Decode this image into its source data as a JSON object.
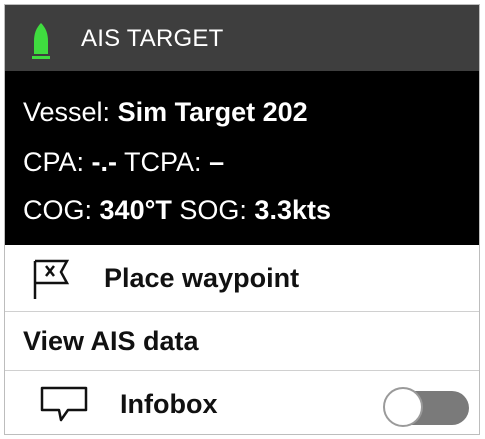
{
  "header": {
    "title": "AIS TARGET",
    "icon": "ais-vessel-icon",
    "icon_color": "#3fdc3f"
  },
  "info": {
    "vessel_label": "Vessel:",
    "vessel_value": "Sim Target 202",
    "cpa_label": "CPA:",
    "cpa_value": "-.-",
    "tcpa_label": "TCPA:",
    "tcpa_value": "–",
    "cog_label": "COG:",
    "cog_value": "340°T",
    "sog_label": "SOG:",
    "sog_value": "3.3kts"
  },
  "menu": {
    "place_waypoint": {
      "label": "Place waypoint",
      "icon": "waypoint-flag-icon"
    },
    "view_ais_data": {
      "label": "View AIS data"
    },
    "infobox": {
      "label": "Infobox",
      "icon": "infobox-icon",
      "toggle_on": false
    }
  }
}
